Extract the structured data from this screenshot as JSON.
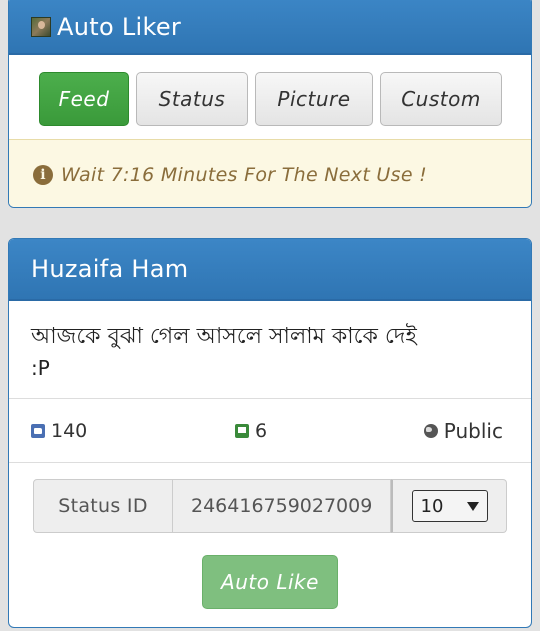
{
  "app": {
    "title": "Auto Liker",
    "tabs": [
      {
        "label": "Feed",
        "active": true
      },
      {
        "label": "Status",
        "active": false
      },
      {
        "label": "Picture",
        "active": false
      },
      {
        "label": "Custom",
        "active": false
      }
    ],
    "alert": "Wait 7:16 Minutes For The Next Use !"
  },
  "post": {
    "author": "Huzaifa Ham",
    "text": "আজকে বুঝা গেল আসলে সালাম কাকে দেই",
    "emote": ":P",
    "likes": "140",
    "comments": "6",
    "privacy": "Public"
  },
  "form": {
    "status_id_label": "Status ID",
    "status_id_value": "246416759027009",
    "count_selected": "10",
    "submit_label": "Auto Like"
  },
  "colors": {
    "header_blue": "#3279b6",
    "active_green": "#449d44",
    "alert_bg": "#fcf8e3",
    "alert_text": "#8a6d3b",
    "submit_green": "#7fbf7f"
  },
  "icons": {
    "logo": "profile-photo-icon",
    "alert": "info-circle-icon",
    "likes": "thumbs-up-icon",
    "comments": "comment-icon",
    "privacy": "globe-icon",
    "select": "caret-down-icon"
  }
}
